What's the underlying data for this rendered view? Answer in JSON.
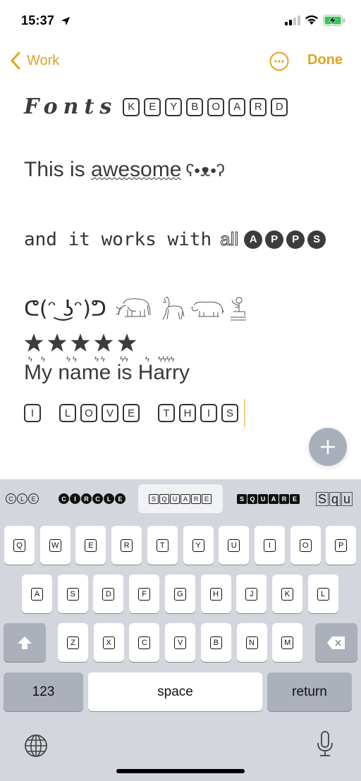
{
  "status_bar": {
    "time": "15:37",
    "location_icon": "location-arrow-icon",
    "signal_icon": "cellular-signal-icon",
    "wifi_icon": "wifi-icon",
    "battery_icon": "battery-charging-icon",
    "battery_color": "#34c759"
  },
  "nav": {
    "back_label": "Work",
    "more_icon": "ellipsis-circle-icon",
    "done_label": "Done",
    "accent_color": "#e2a31e"
  },
  "note": {
    "line1": {
      "script": "Fonts",
      "keys": [
        "K",
        "E",
        "Y",
        "B",
        "O",
        "A",
        "R",
        "D"
      ]
    },
    "line2": {
      "prefix": "This is ",
      "decorated": "awesome",
      "face": "ʕ•ᴥ•ʔ"
    },
    "line3": {
      "mono": "and it works with",
      "outline": "all",
      "circles": [
        "A",
        "P",
        "P",
        "S"
      ]
    },
    "line4": {
      "lenny": "ᕦ(ᵔ ͜ʖᵔ)ᕤ",
      "glyphs": [
        "elephant-icon",
        "horse-icon",
        "hippo-icon",
        "seated-man-icon"
      ]
    },
    "line5": {
      "stars": 5
    },
    "line6": {
      "text": "My name is Harry"
    },
    "line7": {
      "words": [
        [
          "I"
        ],
        [
          "L",
          "O",
          "V",
          "E"
        ],
        [
          "T",
          "H",
          "I",
          "S"
        ]
      ]
    }
  },
  "add_button": {
    "icon": "plus-icon"
  },
  "keyboard": {
    "suggestions": [
      {
        "style": "circle-outline",
        "text": "CLE",
        "active": false
      },
      {
        "style": "circle-filled",
        "text": "CIRCLE",
        "active": false
      },
      {
        "style": "square-outline",
        "text": "SQUARE",
        "active": true
      },
      {
        "style": "square-filled",
        "text": "SQUARE",
        "active": false
      },
      {
        "style": "box",
        "text": "Squ",
        "active": false
      }
    ],
    "row1": [
      "Q",
      "W",
      "E",
      "R",
      "T",
      "Y",
      "U",
      "I",
      "O",
      "P"
    ],
    "row2": [
      "A",
      "S",
      "D",
      "F",
      "G",
      "H",
      "J",
      "K",
      "L"
    ],
    "row3": [
      "Z",
      "X",
      "C",
      "V",
      "B",
      "N",
      "M"
    ],
    "shift_icon": "shift-arrow-icon",
    "delete_icon": "delete-backspace-icon",
    "numbers_label": "123",
    "space_label": "space",
    "return_label": "return",
    "globe_icon": "globe-icon",
    "mic_icon": "microphone-icon"
  }
}
